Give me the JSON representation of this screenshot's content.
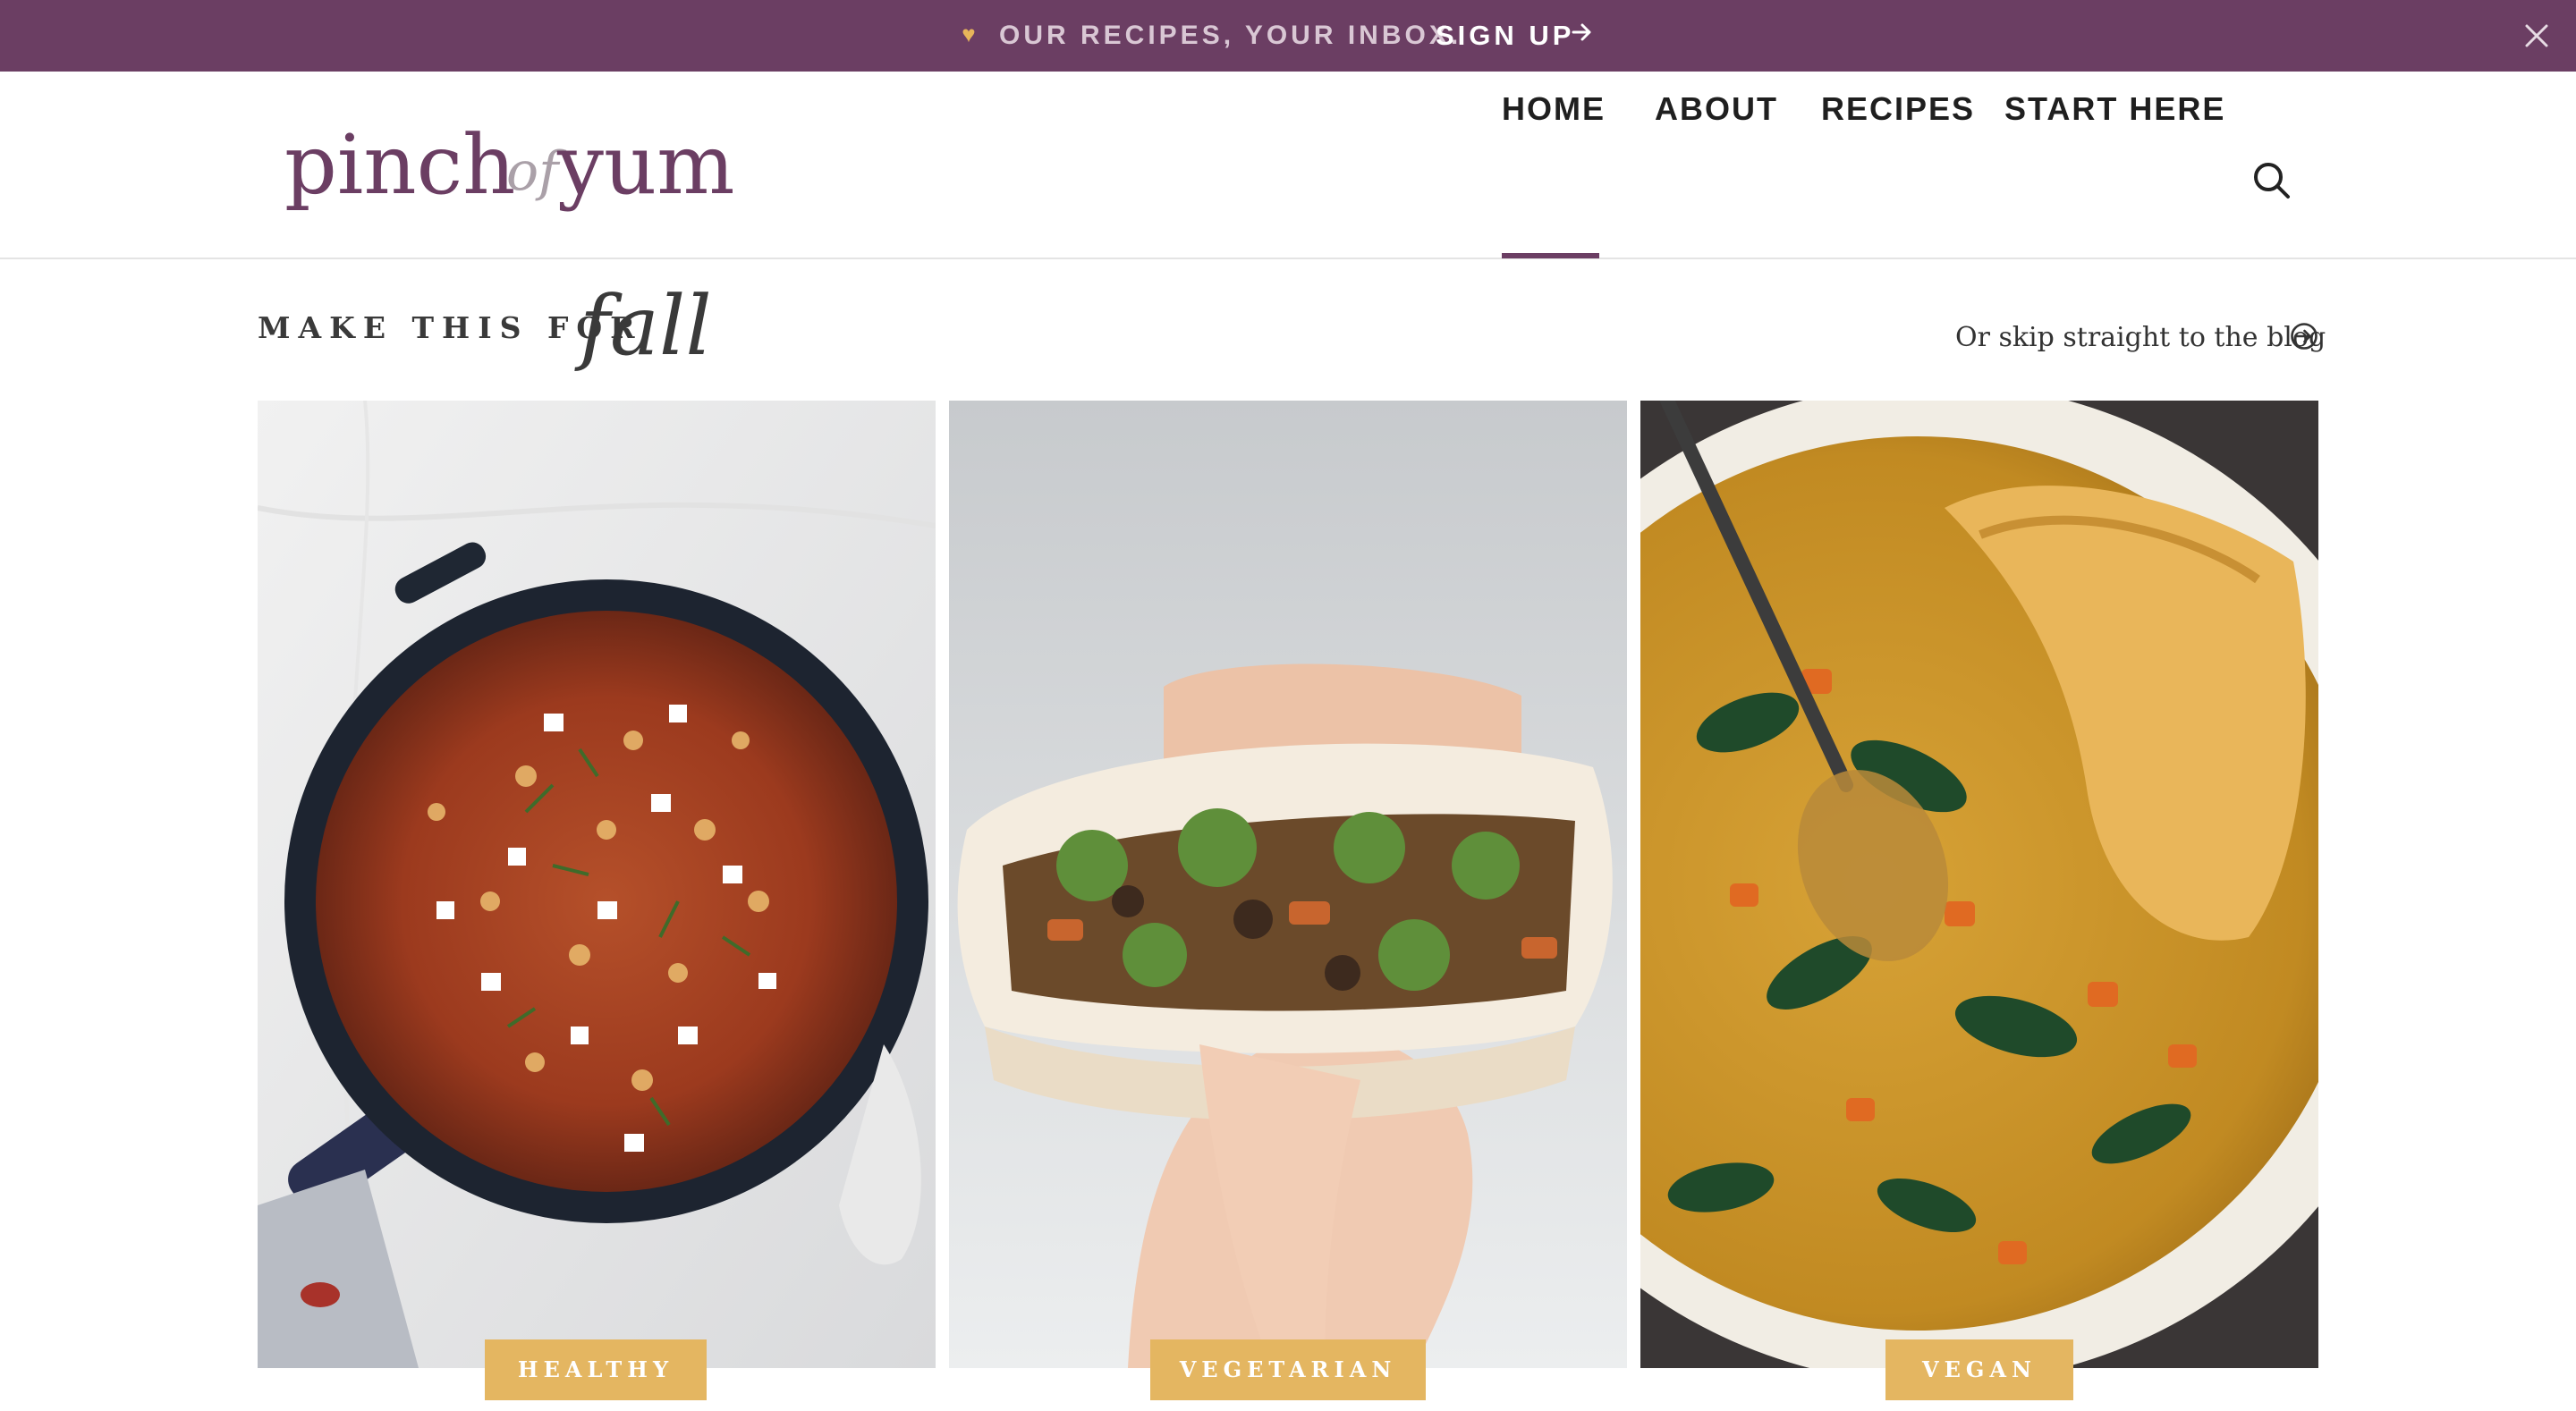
{
  "promo": {
    "heart_icon": "heart-icon",
    "text": "OUR RECIPES, YOUR INBOX.",
    "link_label": "SIGN UP",
    "arrow_icon": "arrow-right-icon",
    "close_icon": "close-icon",
    "bg_color": "#6b3e63"
  },
  "logo": {
    "pinch": "pinch",
    "of": "of",
    "yum": "yum"
  },
  "nav": {
    "items": [
      {
        "label": "HOME",
        "active": true
      },
      {
        "label": "ABOUT",
        "active": false
      },
      {
        "label": "RECIPES",
        "active": false
      },
      {
        "label": "START HERE",
        "active": false
      }
    ],
    "search_icon": "search-icon"
  },
  "section": {
    "title": "MAKE THIS FOR",
    "script": "fall",
    "blog_link": "Or skip straight to the blog",
    "blog_icon": "circle-arrow-right-icon"
  },
  "cards": [
    {
      "badge": "HEALTHY",
      "image": "skillet of orzo with chickpeas, feta and dill"
    },
    {
      "badge": "VEGETARIAN",
      "image": "hand holding stuffed flatbread sandwich"
    },
    {
      "badge": "VEGAN",
      "image": "bowl of lentil spinach curry soup with flatbread"
    }
  ],
  "colors": {
    "accent": "#6b3e63",
    "badge": "#e4b661"
  }
}
